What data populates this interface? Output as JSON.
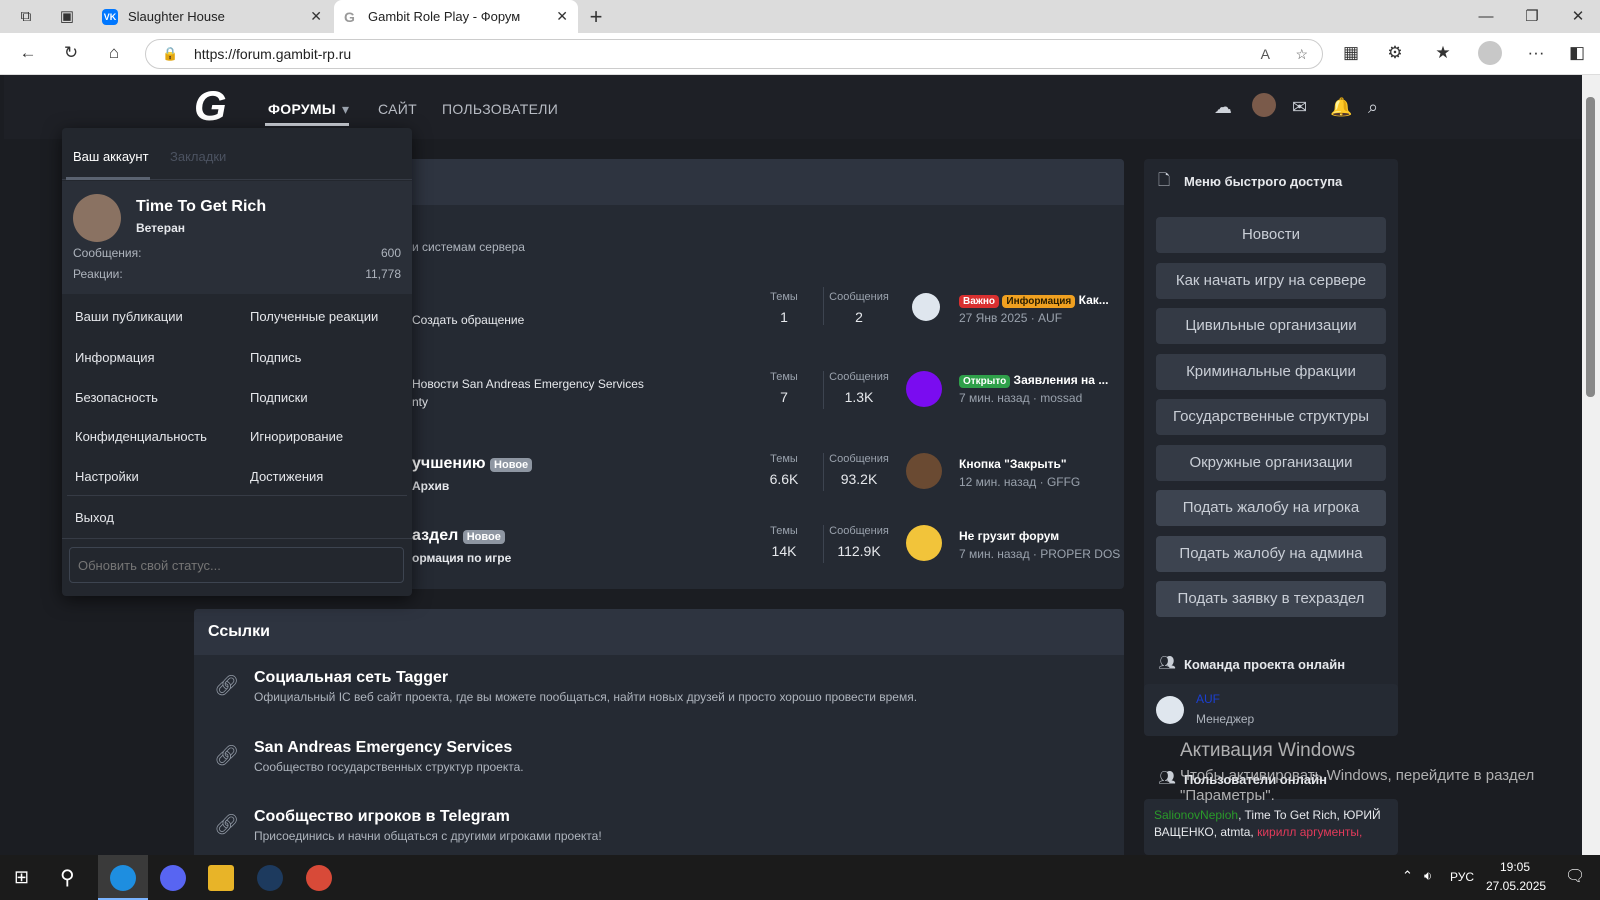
{
  "browser": {
    "tabs": [
      {
        "label": "Slaughter House"
      },
      {
        "label": "Gambit Role Play - Форум"
      }
    ],
    "url": "https://forum.gambit-rp.ru"
  },
  "site": {
    "nav": {
      "forums": "ФОРУМЫ",
      "site": "САЙТ",
      "users": "ПОЛЬЗОВАТЕЛИ"
    },
    "category_fragment": "и системам сервера",
    "forums": [
      {
        "line1": "",
        "line2": "Создать обращение",
        "threads_label": "Темы",
        "threads": "1",
        "posts_label": "Сообщения",
        "posts": "2",
        "badges": [
          "Важно",
          "Информация"
        ],
        "last_title": "Как...",
        "last_meta": "27 Янв 2025 · AUF"
      },
      {
        "line1": "Новости San Andreas Emergency Services",
        "line2": "nty",
        "threads_label": "Темы",
        "threads": "7",
        "posts_label": "Сообщения",
        "posts": "1.3K",
        "badges": [
          "Открыто"
        ],
        "last_title": "Заявления на ...",
        "last_meta": "7 мин. назад · mossad"
      },
      {
        "line1": "учшению",
        "new": "Новое",
        "line2": "Архив",
        "threads_label": "Темы",
        "threads": "6.6K",
        "posts_label": "Сообщения",
        "posts": "93.2K",
        "badges": [],
        "last_title": "Кнопка \"Закрыть\"",
        "last_meta": "12 мин. назад · GFFG"
      },
      {
        "line1": "аздел",
        "new": "Новое",
        "line2": "ормация по игре",
        "threads_label": "Темы",
        "threads": "14K",
        "posts_label": "Сообщения",
        "posts": "112.9K",
        "badges": [],
        "last_title": "Не грузит форум",
        "last_meta": "7 мин. назад · PROPER DOS"
      }
    ],
    "links": {
      "header": "Ссылки",
      "items": [
        {
          "title": "Социальная сеть Tagger",
          "desc": "Официальный IC веб сайт проекта, где вы можете пообщаться, найти новых друзей и просто хорошо провести время."
        },
        {
          "title": "San Andreas Emergency Services",
          "desc": "Сообщество государственных структур проекта."
        },
        {
          "title": "Сообщество игроков в Telegram",
          "desc": "Присоединись и начни общаться с другими игроками проекта!"
        }
      ]
    },
    "quick_access": {
      "title": "Меню быстрого доступа",
      "buttons": [
        "Новости",
        "Как начать игру на сервере",
        "Цивильные организации",
        "Криминальные фракции",
        "Государственные структуры",
        "Окружные организации",
        "Подать жалобу на игрока",
        "Подать жалобу на админа",
        "Подать заявку в техраздел"
      ]
    },
    "staff_online": {
      "title": "Команда проекта онлайн",
      "name": "AUF",
      "role": "Менеджер"
    },
    "users_online": {
      "title": "Пользователи онлайн",
      "u1": "SalionovNepioh",
      "u2": ", Time To Get Rich, ЮРИЙ",
      "u3": "ВАЩЕНКО, atmta, ",
      "u4": "кирилл аргументы,"
    },
    "dropdown": {
      "tab_account": "Ваш аккаунт",
      "tab_bookmarks": "Закладки",
      "username": "Time To Get Rich",
      "rank": "Ветеран",
      "messages_label": "Сообщения:",
      "messages": "600",
      "reactions_label": "Реакции:",
      "reactions": "11,778",
      "links": [
        "Ваши публикации",
        "Полученные реакции",
        "Информация",
        "Подпись",
        "Безопасность",
        "Подписки",
        "Конфиденциальность",
        "Игнорирование",
        "Настройки",
        "Достижения"
      ],
      "logout": "Выход",
      "status_placeholder": "Обновить свой статус..."
    }
  },
  "windows": {
    "activation_title": "Активация Windows",
    "activation_text1": "Чтобы активировать Windows, перейдите в раздел",
    "activation_text2": "\"Параметры\".",
    "lang": "РУС",
    "time": "19:05",
    "date": "27.05.2025"
  }
}
